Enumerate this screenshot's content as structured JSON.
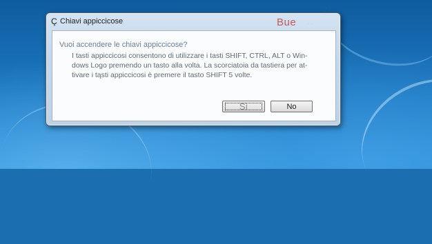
{
  "dialog": {
    "icon": "Ç",
    "title": "Chiavi appiccicose",
    "overlay_text": "Bue",
    "caption_buttons": "◦ ◦"
  },
  "content": {
    "question": "Vuoi accendere le chiavi appiccicose?",
    "line1": "I tasti appiccicosi consentono di utilizzare i tasti SHIFT, CTRL, ALT o Win-",
    "line2": "dows Logo premendo un tasto alla volta. La scorciatoia da tastiera per at-",
    "line3": "tivare i tąsti appiccicosi è premere il tasto SHIFT 5 volte."
  },
  "buttons": {
    "yes_label": "Sì",
    "no_label": "No"
  },
  "colors": {
    "desktop": "#1b6fb0",
    "frame": "#c5d7ea",
    "question_text": "#6a7e9a",
    "overlay_red": "#c8565e"
  }
}
